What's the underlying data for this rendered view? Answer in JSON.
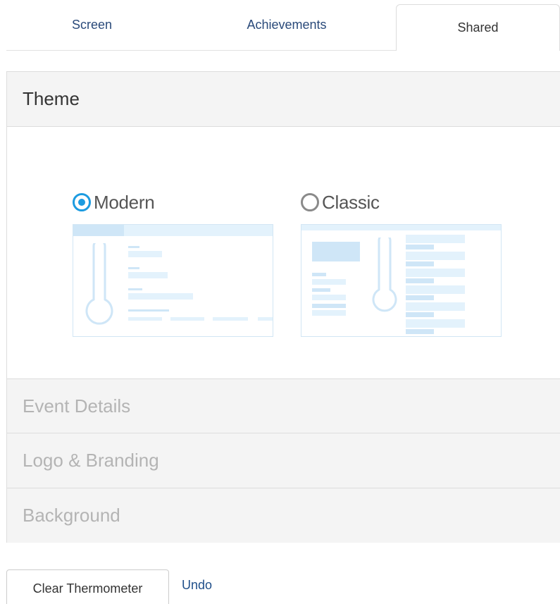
{
  "tabs": [
    {
      "label": "Screen",
      "active": false
    },
    {
      "label": "Achievements",
      "active": false
    },
    {
      "label": "Shared",
      "active": true
    }
  ],
  "sections": {
    "theme": {
      "title": "Theme",
      "expanded": true,
      "options": [
        {
          "label": "Modern",
          "selected": true
        },
        {
          "label": "Classic",
          "selected": false
        }
      ]
    },
    "event_details": {
      "title": "Event Details",
      "expanded": false
    },
    "logo_branding": {
      "title": "Logo & Branding",
      "expanded": false
    },
    "background": {
      "title": "Background",
      "expanded": false
    }
  },
  "actions": {
    "clear_label": "Clear Thermometer",
    "undo_label": "Undo"
  },
  "colors": {
    "accent": "#1c9be0",
    "link": "#1f4f8a",
    "muted_header": "#b4b4b4",
    "preview_fill": "#e3f2fc"
  },
  "icons": {
    "radio_selected": "radio-checked-icon",
    "radio_unselected": "radio-unchecked-icon",
    "thermometer": "thermometer-icon"
  }
}
